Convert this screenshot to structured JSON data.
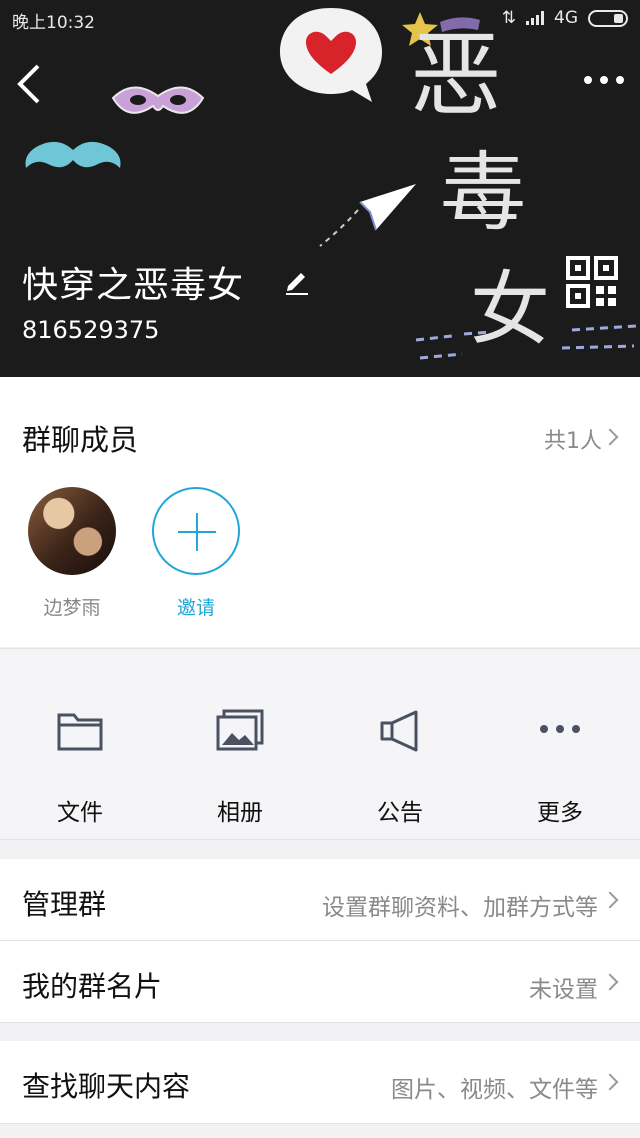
{
  "status_bar": {
    "time": "晚上10:32",
    "network": "4G"
  },
  "header": {
    "group_name": "快穿之恶毒女",
    "group_id": "816529375",
    "art_chars": [
      "恶",
      "毒",
      "女"
    ]
  },
  "members": {
    "title": "群聊成员",
    "count": "共1人",
    "list": [
      {
        "name": "边梦雨"
      }
    ],
    "invite_label": "邀请"
  },
  "quick_actions": [
    {
      "label": "文件",
      "icon": "folder-icon"
    },
    {
      "label": "相册",
      "icon": "album-icon"
    },
    {
      "label": "公告",
      "icon": "megaphone-icon"
    },
    {
      "label": "更多",
      "icon": "more-dots-icon"
    }
  ],
  "settings": {
    "manage_group": {
      "title": "管理群",
      "value": "设置群聊资料、加群方式等"
    },
    "my_card": {
      "title": "我的群名片",
      "value": "未设置"
    },
    "search_history": {
      "title": "查找聊天内容",
      "value": "图片、视频、文件等"
    }
  },
  "colors": {
    "accent": "#22a6d8",
    "header_bg": "#1b1b1b",
    "secondary_text": "#8a8a8a"
  }
}
